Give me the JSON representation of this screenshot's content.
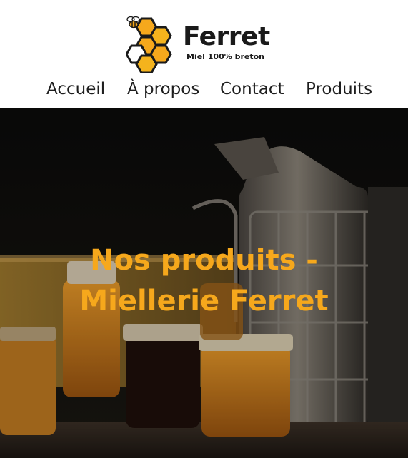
{
  "brand": {
    "name": "Ferret",
    "tagline": "Miel 100% breton",
    "logo_icon": "honeycomb-icon",
    "mascot_icon": "bee-icon",
    "accent_color": "#f6a81c"
  },
  "nav": {
    "items": [
      {
        "label": "Accueil"
      },
      {
        "label": "À propos"
      },
      {
        "label": "Contact"
      },
      {
        "label": "Produits"
      }
    ]
  },
  "hero": {
    "title_line1": "Nos produits -",
    "title_line2": "Miellerie Ferret",
    "image": "honey-jars-and-bee-smoker-photo"
  }
}
